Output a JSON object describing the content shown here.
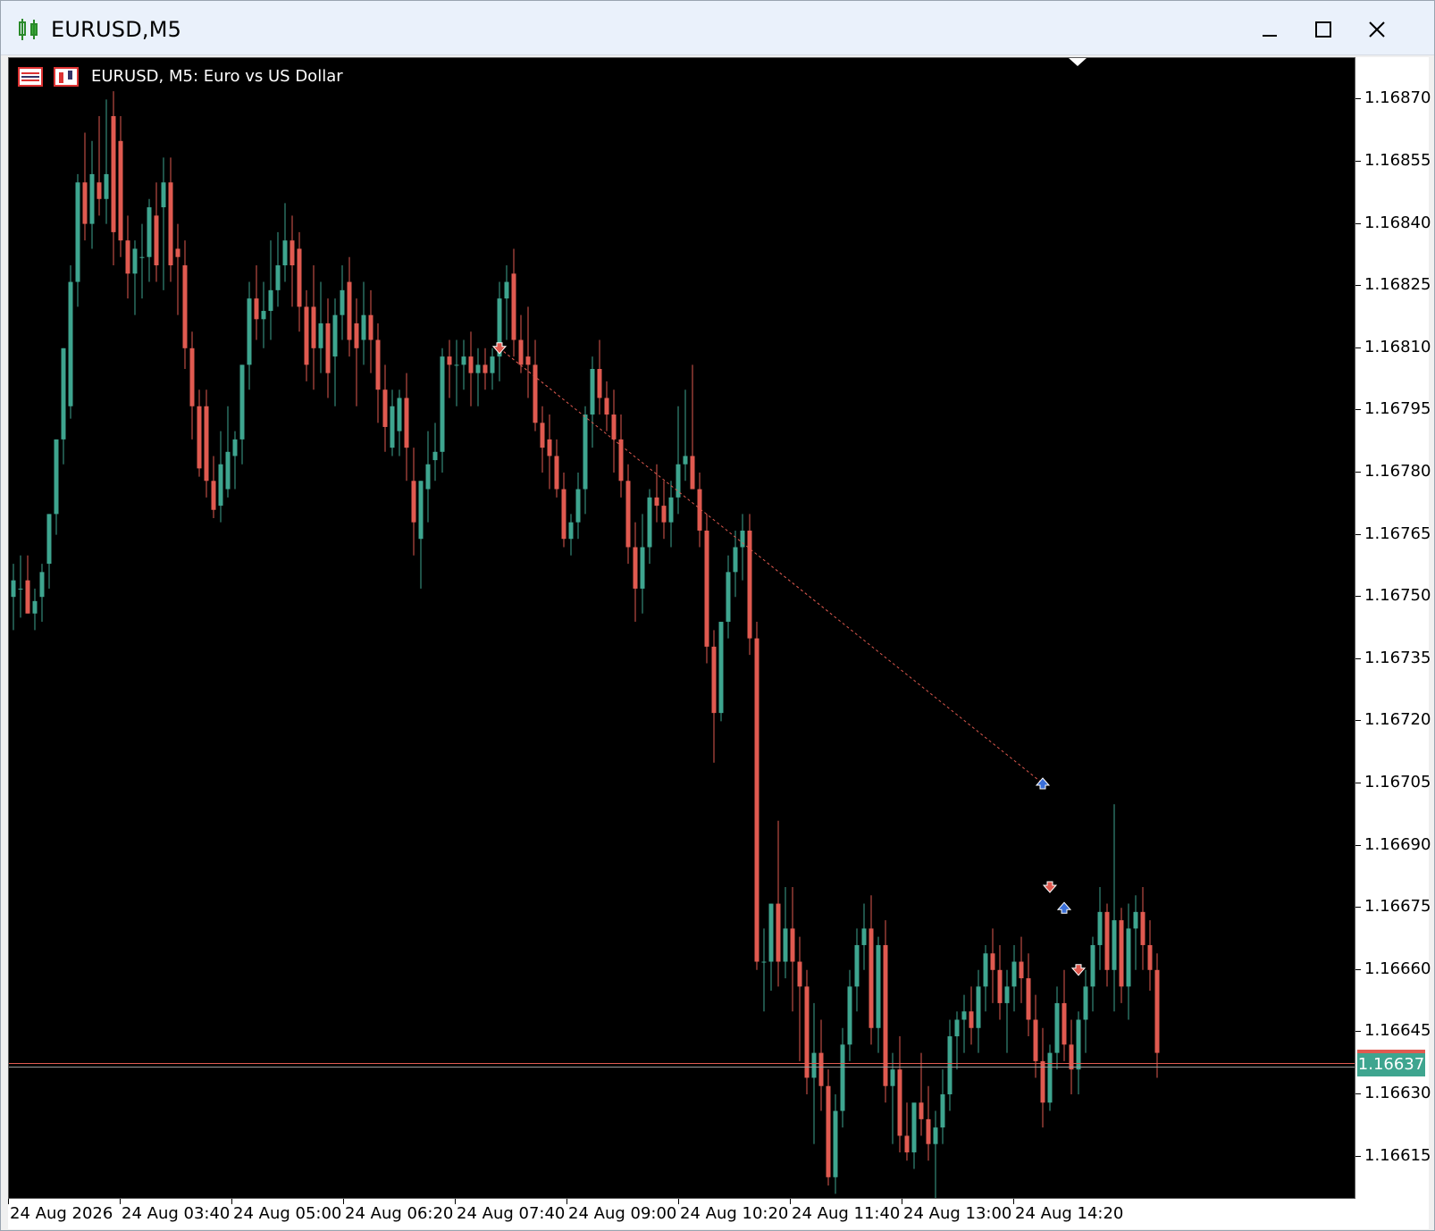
{
  "window": {
    "title": "EURUSD,M5",
    "minimize_icon": "minimize-icon",
    "maximize_icon": "maximize-icon",
    "close_icon": "close-icon"
  },
  "chart": {
    "label": "EURUSD, M5:  Euro vs US Dollar",
    "colors": {
      "background": "#000000",
      "bull": "#3ea58f",
      "bear": "#e05a50",
      "price_line": "#e05a50",
      "grid_text": "#000000"
    }
  },
  "price_scale": {
    "labels": [
      "1.16870",
      "1.16855",
      "1.16840",
      "1.16825",
      "1.16810",
      "1.16795",
      "1.16780",
      "1.16765",
      "1.16750",
      "1.16735",
      "1.16720",
      "1.16705",
      "1.16690",
      "1.16675",
      "1.16660",
      "1.16645",
      "1.16630",
      "1.16615"
    ],
    "current_price": "1.16637"
  },
  "time_scale": {
    "labels": [
      "24 Aug 2026",
      "24 Aug 03:40",
      "24 Aug 05:00",
      "24 Aug 06:20",
      "24 Aug 07:40",
      "24 Aug 09:00",
      "24 Aug 10:20",
      "24 Aug 11:40",
      "24 Aug 13:00",
      "24 Aug 14:20"
    ]
  },
  "chart_data": {
    "type": "candlestick",
    "symbol": "EURUSD",
    "timeframe": "M5",
    "ylim": [
      1.16605,
      1.1688
    ],
    "candles": [
      [
        1.1675,
        1.16758,
        1.16742,
        1.16754
      ],
      [
        1.16752,
        1.1676,
        1.16745,
        1.16752
      ],
      [
        1.16754,
        1.1676,
        1.16746,
        1.16746
      ],
      [
        1.16746,
        1.16752,
        1.16742,
        1.16749
      ],
      [
        1.1675,
        1.16758,
        1.16744,
        1.16756
      ],
      [
        1.16758,
        1.1677,
        1.16752,
        1.1677
      ],
      [
        1.1677,
        1.16788,
        1.16765,
        1.16788
      ],
      [
        1.16788,
        1.1681,
        1.16782,
        1.1681
      ],
      [
        1.16796,
        1.1683,
        1.16793,
        1.16826
      ],
      [
        1.16826,
        1.16852,
        1.1682,
        1.1685
      ],
      [
        1.1685,
        1.16862,
        1.16836,
        1.1684
      ],
      [
        1.1684,
        1.1686,
        1.16834,
        1.16852
      ],
      [
        1.1685,
        1.16866,
        1.16842,
        1.16846
      ],
      [
        1.16846,
        1.1687,
        1.1684,
        1.16852
      ],
      [
        1.16866,
        1.16872,
        1.1683,
        1.16838
      ],
      [
        1.1686,
        1.16866,
        1.16832,
        1.16836
      ],
      [
        1.16836,
        1.16842,
        1.16822,
        1.16828
      ],
      [
        1.16828,
        1.16836,
        1.16818,
        1.16834
      ],
      [
        1.16832,
        1.1684,
        1.16822,
        1.16832
      ],
      [
        1.16832,
        1.16846,
        1.16826,
        1.16844
      ],
      [
        1.16842,
        1.1685,
        1.16826,
        1.1683
      ],
      [
        1.16844,
        1.16856,
        1.16824,
        1.1685
      ],
      [
        1.1685,
        1.16856,
        1.16826,
        1.1683
      ],
      [
        1.16834,
        1.1684,
        1.16818,
        1.16832
      ],
      [
        1.1683,
        1.16836,
        1.16805,
        1.1681
      ],
      [
        1.1681,
        1.16814,
        1.16788,
        1.16796
      ],
      [
        1.16796,
        1.168,
        1.16779,
        1.16781
      ],
      [
        1.16796,
        1.168,
        1.16774,
        1.16778
      ],
      [
        1.16778,
        1.16784,
        1.16769,
        1.16771
      ],
      [
        1.16772,
        1.1679,
        1.16768,
        1.16782
      ],
      [
        1.16776,
        1.16796,
        1.16774,
        1.16785
      ],
      [
        1.16784,
        1.1679,
        1.16776,
        1.16788
      ],
      [
        1.16788,
        1.16806,
        1.16782,
        1.16806
      ],
      [
        1.16806,
        1.16826,
        1.168,
        1.16822
      ],
      [
        1.16822,
        1.1683,
        1.16812,
        1.16817
      ],
      [
        1.16817,
        1.16826,
        1.1681,
        1.16819
      ],
      [
        1.16819,
        1.16836,
        1.16812,
        1.16824
      ],
      [
        1.16824,
        1.16838,
        1.1682,
        1.1683
      ],
      [
        1.1683,
        1.16845,
        1.16826,
        1.16836
      ],
      [
        1.16836,
        1.16842,
        1.1682,
        1.1683
      ],
      [
        1.16834,
        1.16838,
        1.16814,
        1.1682
      ],
      [
        1.1682,
        1.16824,
        1.16802,
        1.16806
      ],
      [
        1.1682,
        1.1683,
        1.168,
        1.1681
      ],
      [
        1.1681,
        1.16826,
        1.16804,
        1.16816
      ],
      [
        1.16816,
        1.16822,
        1.16798,
        1.16804
      ],
      [
        1.16808,
        1.16822,
        1.16796,
        1.16818
      ],
      [
        1.16818,
        1.1683,
        1.16812,
        1.16824
      ],
      [
        1.16826,
        1.16832,
        1.16808,
        1.16812
      ],
      [
        1.16816,
        1.16822,
        1.16796,
        1.1681
      ],
      [
        1.16812,
        1.16826,
        1.16806,
        1.16818
      ],
      [
        1.16818,
        1.16824,
        1.16804,
        1.16812
      ],
      [
        1.16812,
        1.16816,
        1.16792,
        1.168
      ],
      [
        1.168,
        1.16806,
        1.16785,
        1.16791
      ],
      [
        1.16786,
        1.168,
        1.16784,
        1.16796
      ],
      [
        1.1679,
        1.168,
        1.16784,
        1.16798
      ],
      [
        1.16798,
        1.16804,
        1.16778,
        1.16786
      ],
      [
        1.16778,
        1.16786,
        1.1676,
        1.16768
      ],
      [
        1.16764,
        1.16778,
        1.16752,
        1.16778
      ],
      [
        1.16776,
        1.1679,
        1.16768,
        1.16782
      ],
      [
        1.16783,
        1.16792,
        1.16778,
        1.16785
      ],
      [
        1.16785,
        1.1681,
        1.1678,
        1.16808
      ],
      [
        1.16808,
        1.16812,
        1.16798,
        1.16806
      ],
      [
        1.16806,
        1.16812,
        1.16796,
        1.16806
      ],
      [
        1.16806,
        1.16812,
        1.168,
        1.16808
      ],
      [
        1.16808,
        1.16814,
        1.16796,
        1.16804
      ],
      [
        1.16804,
        1.1681,
        1.16796,
        1.16806
      ],
      [
        1.16806,
        1.1681,
        1.168,
        1.16804
      ],
      [
        1.16804,
        1.1681,
        1.168,
        1.16808
      ],
      [
        1.16808,
        1.16826,
        1.16802,
        1.16822
      ],
      [
        1.16822,
        1.1683,
        1.16812,
        1.16826
      ],
      [
        1.16828,
        1.16834,
        1.16808,
        1.16812
      ],
      [
        1.16812,
        1.16818,
        1.16804,
        1.16806
      ],
      [
        1.16808,
        1.1682,
        1.16798,
        1.16806
      ],
      [
        1.16806,
        1.16812,
        1.1679,
        1.16792
      ],
      [
        1.16792,
        1.16796,
        1.1678,
        1.16786
      ],
      [
        1.16788,
        1.16794,
        1.16776,
        1.16784
      ],
      [
        1.16784,
        1.16788,
        1.16774,
        1.16776
      ],
      [
        1.16776,
        1.1678,
        1.16762,
        1.16764
      ],
      [
        1.16764,
        1.1677,
        1.1676,
        1.16768
      ],
      [
        1.16768,
        1.1678,
        1.16764,
        1.16776
      ],
      [
        1.16776,
        1.16796,
        1.1677,
        1.16794
      ],
      [
        1.16794,
        1.16808,
        1.16786,
        1.16805
      ],
      [
        1.16805,
        1.16812,
        1.16794,
        1.16798
      ],
      [
        1.16798,
        1.16802,
        1.1679,
        1.16794
      ],
      [
        1.16794,
        1.168,
        1.1678,
        1.16788
      ],
      [
        1.16788,
        1.16794,
        1.16774,
        1.16778
      ],
      [
        1.16778,
        1.16782,
        1.16758,
        1.16762
      ],
      [
        1.16762,
        1.16768,
        1.16744,
        1.16752
      ],
      [
        1.16752,
        1.1677,
        1.16746,
        1.16762
      ],
      [
        1.16762,
        1.16776,
        1.16758,
        1.16774
      ],
      [
        1.16774,
        1.16782,
        1.16768,
        1.16772
      ],
      [
        1.16772,
        1.16778,
        1.16764,
        1.16768
      ],
      [
        1.16768,
        1.16778,
        1.16762,
        1.16774
      ],
      [
        1.16774,
        1.16796,
        1.1677,
        1.16782
      ],
      [
        1.16782,
        1.168,
        1.16778,
        1.16784
      ],
      [
        1.16784,
        1.16806,
        1.16778,
        1.16776
      ],
      [
        1.16776,
        1.1678,
        1.16762,
        1.16766
      ],
      [
        1.16766,
        1.1677,
        1.16734,
        1.16738
      ],
      [
        1.16738,
        1.16742,
        1.1671,
        1.16722
      ],
      [
        1.16722,
        1.1674,
        1.1672,
        1.16744
      ],
      [
        1.16744,
        1.1676,
        1.1674,
        1.16756
      ],
      [
        1.16756,
        1.16766,
        1.1675,
        1.16762
      ],
      [
        1.16762,
        1.1677,
        1.16754,
        1.16766
      ],
      [
        1.16766,
        1.1677,
        1.16736,
        1.1674
      ],
      [
        1.1674,
        1.16744,
        1.1666,
        1.16662
      ],
      [
        1.16662,
        1.1667,
        1.1665,
        1.16662
      ],
      [
        1.16662,
        1.16676,
        1.16655,
        1.16676
      ],
      [
        1.16676,
        1.16696,
        1.16656,
        1.16662
      ],
      [
        1.16662,
        1.1668,
        1.16658,
        1.1667
      ],
      [
        1.1667,
        1.1668,
        1.1665,
        1.16662
      ],
      [
        1.16662,
        1.16668,
        1.16638,
        1.16656
      ],
      [
        1.16656,
        1.1666,
        1.1663,
        1.16634
      ],
      [
        1.16634,
        1.16652,
        1.16618,
        1.1664
      ],
      [
        1.1664,
        1.16648,
        1.16626,
        1.16632
      ],
      [
        1.16632,
        1.16636,
        1.16608,
        1.1661
      ],
      [
        1.1661,
        1.1663,
        1.16606,
        1.16626
      ],
      [
        1.16626,
        1.16646,
        1.16622,
        1.16642
      ],
      [
        1.16642,
        1.1666,
        1.16638,
        1.16656
      ],
      [
        1.16656,
        1.1667,
        1.1665,
        1.16666
      ],
      [
        1.16666,
        1.16676,
        1.1666,
        1.1667
      ],
      [
        1.1667,
        1.16678,
        1.16642,
        1.16646
      ],
      [
        1.16646,
        1.16668,
        1.1664,
        1.16666
      ],
      [
        1.16666,
        1.16672,
        1.16628,
        1.16632
      ],
      [
        1.16632,
        1.1664,
        1.16618,
        1.16636
      ],
      [
        1.16636,
        1.16644,
        1.16616,
        1.1662
      ],
      [
        1.1662,
        1.16628,
        1.16614,
        1.16616
      ],
      [
        1.16616,
        1.16624,
        1.16612,
        1.16628
      ],
      [
        1.16628,
        1.1664,
        1.1662,
        1.16624
      ],
      [
        1.16624,
        1.16632,
        1.16614,
        1.16618
      ],
      [
        1.16618,
        1.16626,
        1.16604,
        1.16622
      ],
      [
        1.16622,
        1.16636,
        1.16618,
        1.1663
      ],
      [
        1.1663,
        1.16648,
        1.16626,
        1.16644
      ],
      [
        1.16644,
        1.1665,
        1.16636,
        1.16648
      ],
      [
        1.16648,
        1.16654,
        1.1664,
        1.1665
      ],
      [
        1.1665,
        1.16656,
        1.16642,
        1.16646
      ],
      [
        1.16646,
        1.1666,
        1.1664,
        1.16656
      ],
      [
        1.16656,
        1.16666,
        1.1665,
        1.16664
      ],
      [
        1.16664,
        1.1667,
        1.16652,
        1.1666
      ],
      [
        1.1666,
        1.16666,
        1.16648,
        1.16652
      ],
      [
        1.16652,
        1.1666,
        1.1664,
        1.16656
      ],
      [
        1.16656,
        1.16666,
        1.1665,
        1.16662
      ],
      [
        1.16662,
        1.16668,
        1.16652,
        1.16658
      ],
      [
        1.16658,
        1.16664,
        1.16644,
        1.16648
      ],
      [
        1.16648,
        1.16654,
        1.16634,
        1.16638
      ],
      [
        1.16638,
        1.16646,
        1.16622,
        1.16628
      ],
      [
        1.16628,
        1.16642,
        1.16626,
        1.1664
      ],
      [
        1.1664,
        1.16656,
        1.16636,
        1.16652
      ],
      [
        1.16652,
        1.1666,
        1.16638,
        1.16642
      ],
      [
        1.16642,
        1.16648,
        1.1663,
        1.16636
      ],
      [
        1.16636,
        1.1665,
        1.1663,
        1.16648
      ],
      [
        1.16648,
        1.1666,
        1.1664,
        1.16656
      ],
      [
        1.16656,
        1.16668,
        1.1665,
        1.16666
      ],
      [
        1.16666,
        1.1668,
        1.1666,
        1.16674
      ],
      [
        1.16674,
        1.16676,
        1.16656,
        1.1666
      ],
      [
        1.1666,
        1.167,
        1.1665,
        1.16672
      ],
      [
        1.16672,
        1.16675,
        1.16652,
        1.16656
      ],
      [
        1.16656,
        1.16676,
        1.16648,
        1.1667
      ],
      [
        1.1667,
        1.16678,
        1.1666,
        1.16674
      ],
      [
        1.16674,
        1.1668,
        1.1666,
        1.16666
      ],
      [
        1.16666,
        1.16672,
        1.16655,
        1.1666
      ],
      [
        1.1666,
        1.16664,
        1.16634,
        1.1664
      ]
    ],
    "markers": [
      {
        "type": "sell",
        "price": 1.1681,
        "index": 68
      },
      {
        "type": "buy",
        "price": 1.16705,
        "index": 144
      },
      {
        "type": "sell",
        "price": 1.1668,
        "index": 145
      },
      {
        "type": "buy",
        "price": 1.16675,
        "index": 147
      },
      {
        "type": "sell",
        "price": 1.1666,
        "index": 149
      }
    ],
    "trend_line": {
      "from": {
        "index": 68,
        "price": 1.1681
      },
      "to": {
        "index": 144,
        "price": 1.16705
      }
    },
    "current_price": 1.16637,
    "grid": false
  }
}
